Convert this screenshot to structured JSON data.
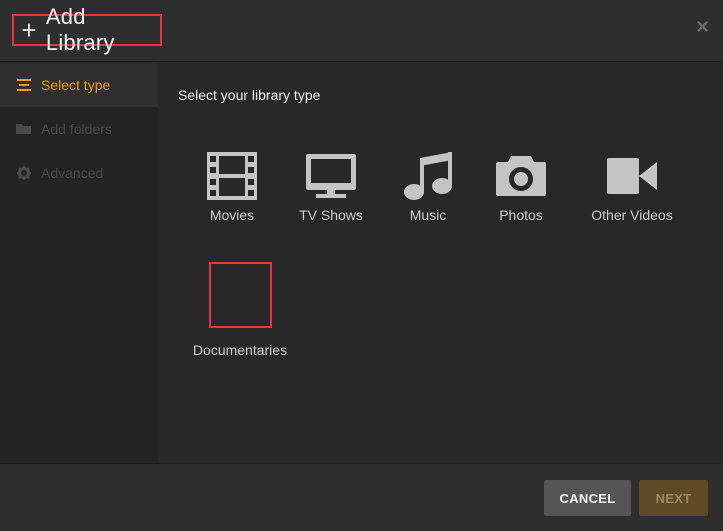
{
  "header": {
    "plus_glyph": "+",
    "title": "Add Library",
    "close_glyph": "×"
  },
  "sidebar": {
    "items": [
      {
        "label": "Select type",
        "icon": "list-icon",
        "active": true
      },
      {
        "label": "Add folders",
        "icon": "folder-icon",
        "active": false
      },
      {
        "label": "Advanced",
        "icon": "gear-icon",
        "active": false
      }
    ]
  },
  "main": {
    "heading": "Select your library type",
    "types": [
      {
        "label": "Movies",
        "icon": "film-icon"
      },
      {
        "label": "TV Shows",
        "icon": "tv-icon"
      },
      {
        "label": "Music",
        "icon": "music-note-icon"
      },
      {
        "label": "Photos",
        "icon": "camera-icon"
      },
      {
        "label": "Other Videos",
        "icon": "video-camera-icon"
      },
      {
        "label": "Documentaries",
        "icon": "blank-box"
      }
    ]
  },
  "footer": {
    "cancel_label": "CANCEL",
    "next_label": "NEXT"
  },
  "colors": {
    "accent": "#e5a00d",
    "highlight_border": "#e0393e",
    "background": "#282828"
  }
}
